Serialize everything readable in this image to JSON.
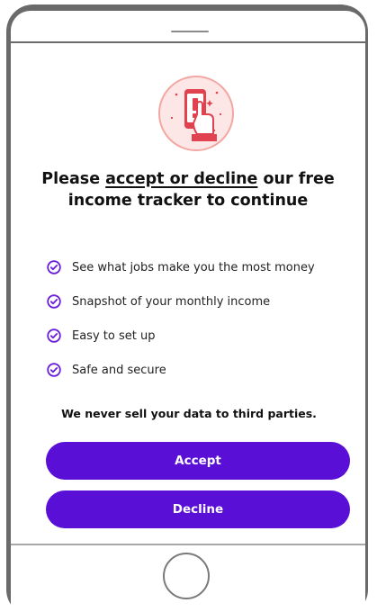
{
  "consent": {
    "heading_prefix": "Please ",
    "heading_emphasis": "accept or decline",
    "heading_suffix": " our free income tracker to continue",
    "benefits": [
      {
        "label": "See what jobs make you the most money"
      },
      {
        "label": "Snapshot of your monthly income"
      },
      {
        "label": "Easy to set up"
      },
      {
        "label": "Safe and secure"
      }
    ],
    "privacy_note": "We never sell your data to third parties.",
    "accept_label": "Accept",
    "decline_label": "Decline"
  },
  "icons": {
    "hero": "phone-alert-hand-icon",
    "benefit": "check-circle-icon"
  },
  "colors": {
    "primary_button": "#5a0fd6",
    "check_icon": "#6a1ed8",
    "hero_accent": "#e0424f",
    "hero_background": "#fde7e6",
    "device_frame": "#6a6a6a"
  }
}
